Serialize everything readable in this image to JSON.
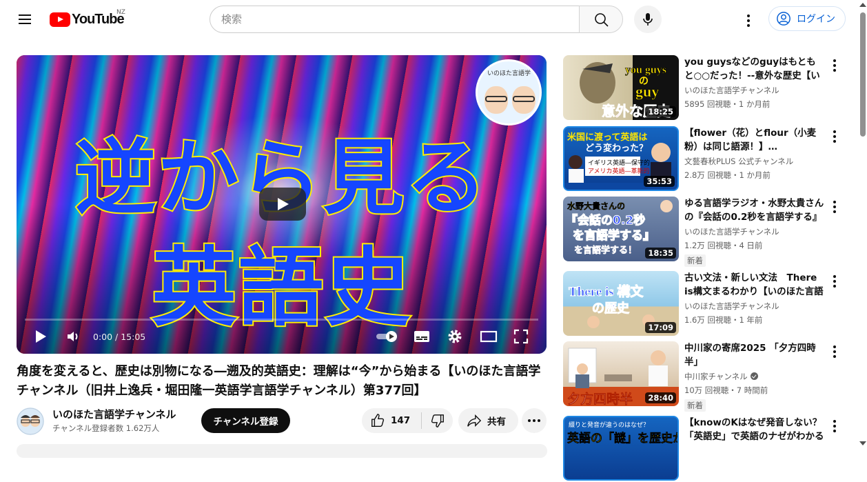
{
  "header": {
    "logo_text": "YouTube",
    "region": "NZ",
    "search_placeholder": "検索",
    "login_label": "ログイン"
  },
  "player": {
    "thumbnail_line1": "逆から見る",
    "thumbnail_line2": "英語史",
    "badge_text": "いのほた言語学",
    "time": "0:00 / 15:05"
  },
  "video": {
    "title": "角度を変えると、歴史は別物になる―遡及的英語史：理解は“今”から始まる【いのほた言語学チャンネル（旧井上逸兵・堀田隆一英語学言語学チャンネル）第377回】",
    "channel_name": "いのほた言語学チャンネル",
    "subscribers": "チャンネル登録者数 1.62万人",
    "subscribe_label": "チャンネル登録",
    "like_count": "147",
    "share_label": "共有"
  },
  "recommendations": [
    {
      "title": "you guysなどのguyはもともと○○だった！--意外な歴史【いのほた言語学チャンネル】",
      "channel": "いのほた言語学チャンネル",
      "meta": "5895 回視聴・1 か月前",
      "duration": "18:25",
      "badge": "",
      "verified": false,
      "thumb_text": "you guys の guy 意外な歴史"
    },
    {
      "title": "【flower（花）とflour（小麦粉）は同じ語源！】…",
      "channel": "文藝春秋PLUS 公式チャンネル",
      "meta": "2.8万 回視聴・1 か月前",
      "duration": "35:53",
      "badge": "",
      "verified": false,
      "thumb_text": "米国に渡って英語はどう変わった？"
    },
    {
      "title": "ゆる言語学ラジオ・水野太貴さんの『会話の0.2秒を言語学する』を言語学する！",
      "channel": "いのほた言語学チャンネル",
      "meta": "1.2万 回視聴・4 日前",
      "duration": "18:35",
      "badge": "新着",
      "verified": false,
      "thumb_text": "水野太貴さんの『会話の0.2秒を言語学する』を言語学する！"
    },
    {
      "title": "古い文法・新しい文法　There is構文まるわかり【いのほた言語学チャンネル】",
      "channel": "いのほた言語学チャンネル",
      "meta": "1.6万 回視聴・1 年前",
      "duration": "17:09",
      "badge": "",
      "verified": false,
      "thumb_text": "There is構文の歴史"
    },
    {
      "title": "中川家の寄席2025 「夕方四時半」",
      "channel": "中川家チャンネル",
      "meta": "10万 回視聴・7 時間前",
      "duration": "28:40",
      "badge": "新着",
      "verified": true,
      "thumb_text": "夕方四時半"
    },
    {
      "title": "【knowのKはなぜ発音しない？「英語史」で英語のナゼがわかる",
      "channel": "",
      "meta": "",
      "duration": "",
      "badge": "",
      "verified": false,
      "thumb_text": "英語の「謎」を歴史から読み解く"
    }
  ]
}
